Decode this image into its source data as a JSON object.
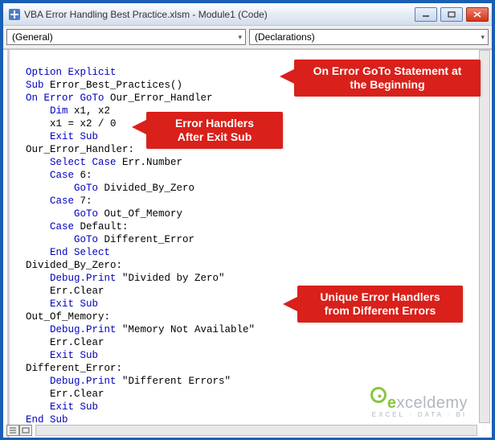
{
  "window": {
    "title": "VBA Error Handling Best Practice.xlsm - Module1 (Code)"
  },
  "dropdowns": {
    "left": "(General)",
    "right": "(Declarations)"
  },
  "callouts": {
    "c1_line1": "On Error GoTo Statement at",
    "c1_line2": "the Beginning",
    "c2_line1": "Error Handlers",
    "c2_line2": "After Exit Sub",
    "c3_line1": "Unique Error Handlers",
    "c3_line2": "from Different Errors"
  },
  "code": {
    "l1_a": "Option Explicit",
    "l2_a": "Sub",
    "l2_b": " Error_Best_Practices()",
    "l3_a": "On Error GoTo",
    "l3_b": " Our_Error_Handler",
    "l4_a": "Dim",
    "l4_b": " x1, x2",
    "l5": "    x1 = x2 / 0",
    "l6": "Exit Sub",
    "l7": "Our_Error_Handler:",
    "l8_a": "Select Case",
    "l8_b": " Err.Number",
    "l9_a": "Case",
    "l9_b": " 6:",
    "l10_a": "GoTo",
    "l10_b": " Divided_By_Zero",
    "l11_a": "Case",
    "l11_b": " 7:",
    "l12_a": "GoTo",
    "l12_b": " Out_Of_Memory",
    "l13_a": "Case",
    "l13_b": " Default:",
    "l14_a": "GoTo",
    "l14_b": " Different_Error",
    "l15": "End Select",
    "l16": "Divided_By_Zero:",
    "l17_a": "Debug.Print",
    "l17_b": " \"Divided by Zero\"",
    "l18": "    Err.Clear",
    "l19": "Exit Sub",
    "l20": "Out_Of_Memory:",
    "l21_a": "Debug.Print",
    "l21_b": " \"Memory Not Available\"",
    "l22": "    Err.Clear",
    "l23": "Exit Sub",
    "l24": "Different_Error:",
    "l25_a": "Debug.Print",
    "l25_b": " \"Different Errors\"",
    "l26": "    Err.Clear",
    "l27": "Exit Sub",
    "l28": "End Sub"
  },
  "watermark": {
    "brand_e": "e",
    "brand_rest": "xceldemy",
    "tagline": "EXCEL · DATA · BI"
  }
}
